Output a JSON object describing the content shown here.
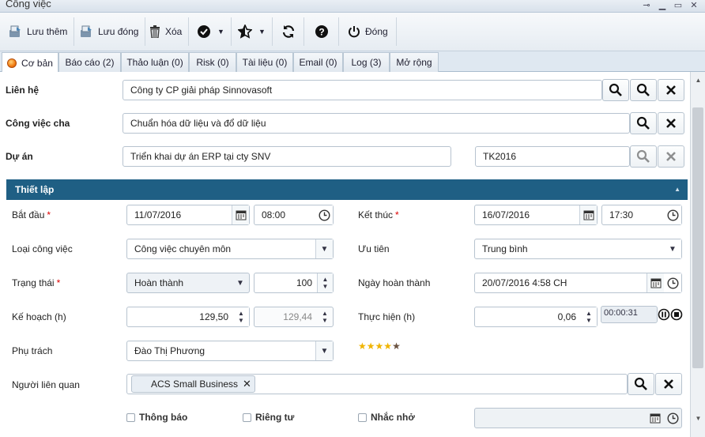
{
  "window": {
    "title": "Công việc"
  },
  "toolbar": {
    "save_new": "Lưu thêm",
    "save_close": "Lưu đóng",
    "delete": "Xóa",
    "close": "Đóng"
  },
  "tabs": [
    {
      "label": "Cơ bản"
    },
    {
      "label": "Báo cáo (2)"
    },
    {
      "label": "Thảo luận (0)"
    },
    {
      "label": "Risk (0)"
    },
    {
      "label": "Tài liệu (0)"
    },
    {
      "label": "Email (0)"
    },
    {
      "label": "Log (3)"
    },
    {
      "label": "Mở rộng"
    }
  ],
  "form": {
    "contact": {
      "label": "Liên hệ",
      "value": "Công ty CP giải pháp Sinnovasoft"
    },
    "parent_task": {
      "label": "Công việc cha",
      "value": "Chuẩn hóa dữ liệu và đổ dữ liệu"
    },
    "project": {
      "label": "Dự án",
      "value": "Triển khai dự án ERP tại cty SNV",
      "code": "TK2016"
    },
    "section_title": "Thiết lập",
    "start": {
      "label": "Bắt đầu",
      "date": "11/07/2016",
      "time": "08:00"
    },
    "end": {
      "label": "Kết thúc",
      "date": "16/07/2016",
      "time": "17:30"
    },
    "task_type": {
      "label": "Loại công việc",
      "value": "Công việc chuyên môn"
    },
    "priority": {
      "label": "Ưu tiên",
      "value": "Trung bình"
    },
    "status": {
      "label": "Trạng thái",
      "value": "Hoàn thành",
      "percent": "100"
    },
    "completed_date": {
      "label": "Ngày hoàn thành",
      "value": "20/07/2016 4:58 CH"
    },
    "plan_hours": {
      "label": "Kế hoạch (h)",
      "value": "129,50",
      "value2": "129,44"
    },
    "actual_hours": {
      "label": "Thực hiện (h)",
      "value": "0,06",
      "timer": "00:00:31"
    },
    "owner": {
      "label": "Phụ trách",
      "value": "Đào Thị Phương"
    },
    "rating": 4,
    "related": {
      "label": "Người liên quan",
      "tag": "ACS Small Business"
    },
    "checkbox_notify": "Thông báo",
    "checkbox_private": "Riêng tư",
    "checkbox_remind": "Nhắc nhở",
    "required_mark": "*"
  },
  "colors": {
    "section": "#1f5f84",
    "star": "#f0b400",
    "star_empty": "#6b5240"
  }
}
